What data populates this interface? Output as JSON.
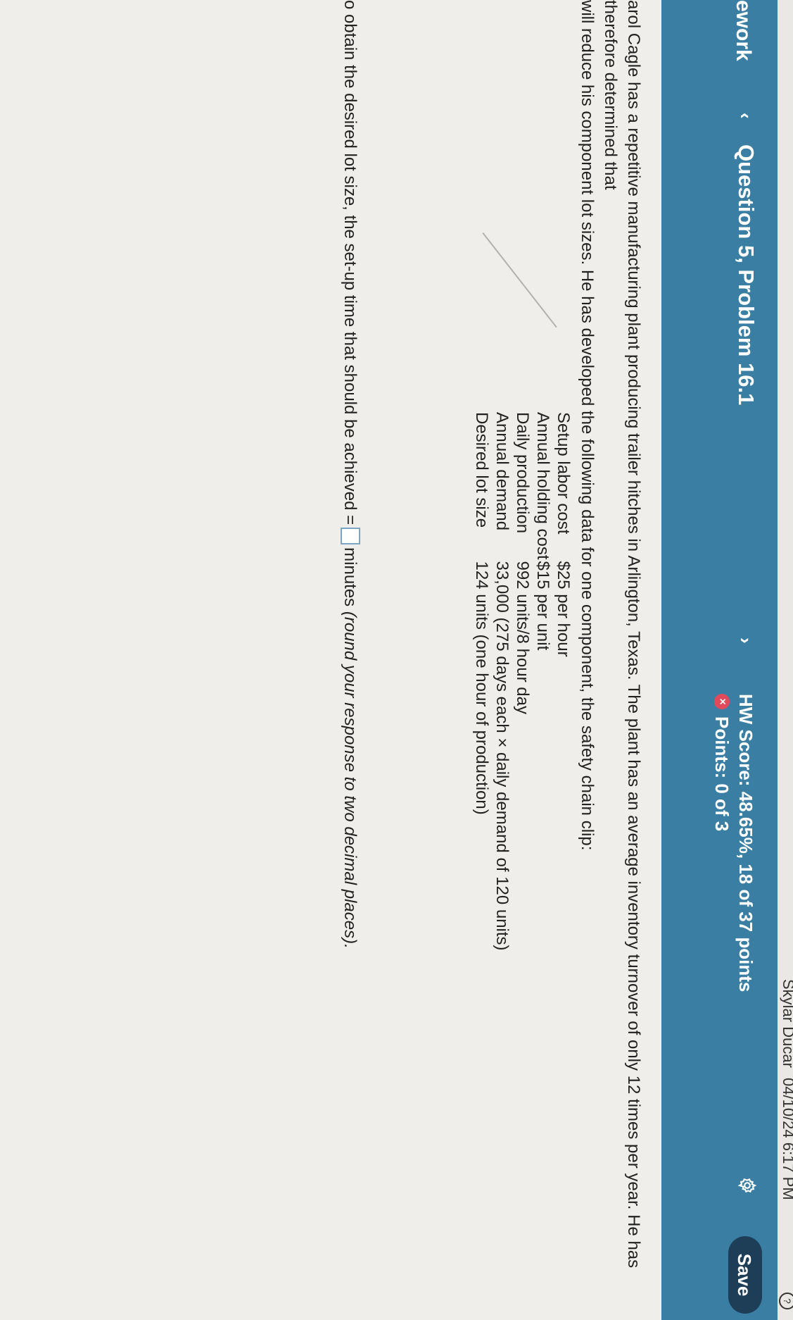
{
  "status_bar": {
    "user": "Skylar Ducar",
    "datetime": "04/10/24 6:17 PM",
    "help_icon": "?"
  },
  "header": {
    "brand": "ework",
    "prev_icon": "‹",
    "question_title": "Question 5, Problem 16.1",
    "next_icon": "›",
    "hw_score": "HW Score: 48.65%, 18 of 37 points",
    "points": "Points: 0 of 3",
    "points_icon": "×",
    "save_label": "Save",
    "accent": "#3a7fa3"
  },
  "problem": {
    "line1": "arol Cagle has a repetitive manufacturing plant producing trailer hitches in Arlington, Texas. The plant has an average inventory turnover of only 12 times per year. He has therefore determined that",
    "line2": "will reduce his component lot sizes. He has developed the following data for one component, the safety chain clip:",
    "data_rows": [
      {
        "label": "Setup labor cost",
        "value": "$25 per hour"
      },
      {
        "label": "Annual holding cost",
        "value": "$15 per unit"
      },
      {
        "label": "Daily production",
        "value": "992 units/8 hour day"
      },
      {
        "label": "Annual demand",
        "value": "33,000 (275 days each × daily demand of 120 units)"
      },
      {
        "label": "Desired lot size",
        "value": "124 units (one hour of production)"
      }
    ]
  },
  "answer": {
    "prefix": "o obtain the desired lot size, the set-up time that should be achieved =",
    "unit": "minutes",
    "hint": "(round your response to two decimal places)."
  }
}
